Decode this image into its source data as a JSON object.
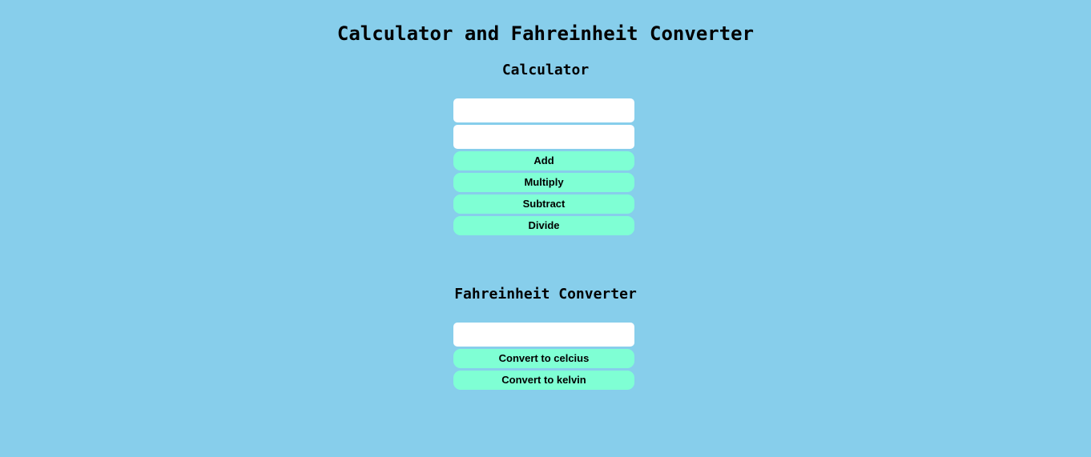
{
  "page": {
    "title": "Calculator and Fahreinheit Converter"
  },
  "calculator": {
    "heading": "Calculator",
    "input1": {
      "value": "",
      "placeholder": ""
    },
    "input2": {
      "value": "",
      "placeholder": ""
    },
    "buttons": {
      "add": "Add",
      "multiply": "Multiply",
      "subtract": "Subtract",
      "divide": "Divide"
    }
  },
  "converter": {
    "heading": "Fahreinheit Converter",
    "input": {
      "value": "",
      "placeholder": ""
    },
    "buttons": {
      "celcius": "Convert to celcius",
      "kelvin": "Convert to kelvin"
    }
  },
  "colors": {
    "background": "#87ceeb",
    "button": "#7fffd4",
    "input": "#ffffff"
  }
}
